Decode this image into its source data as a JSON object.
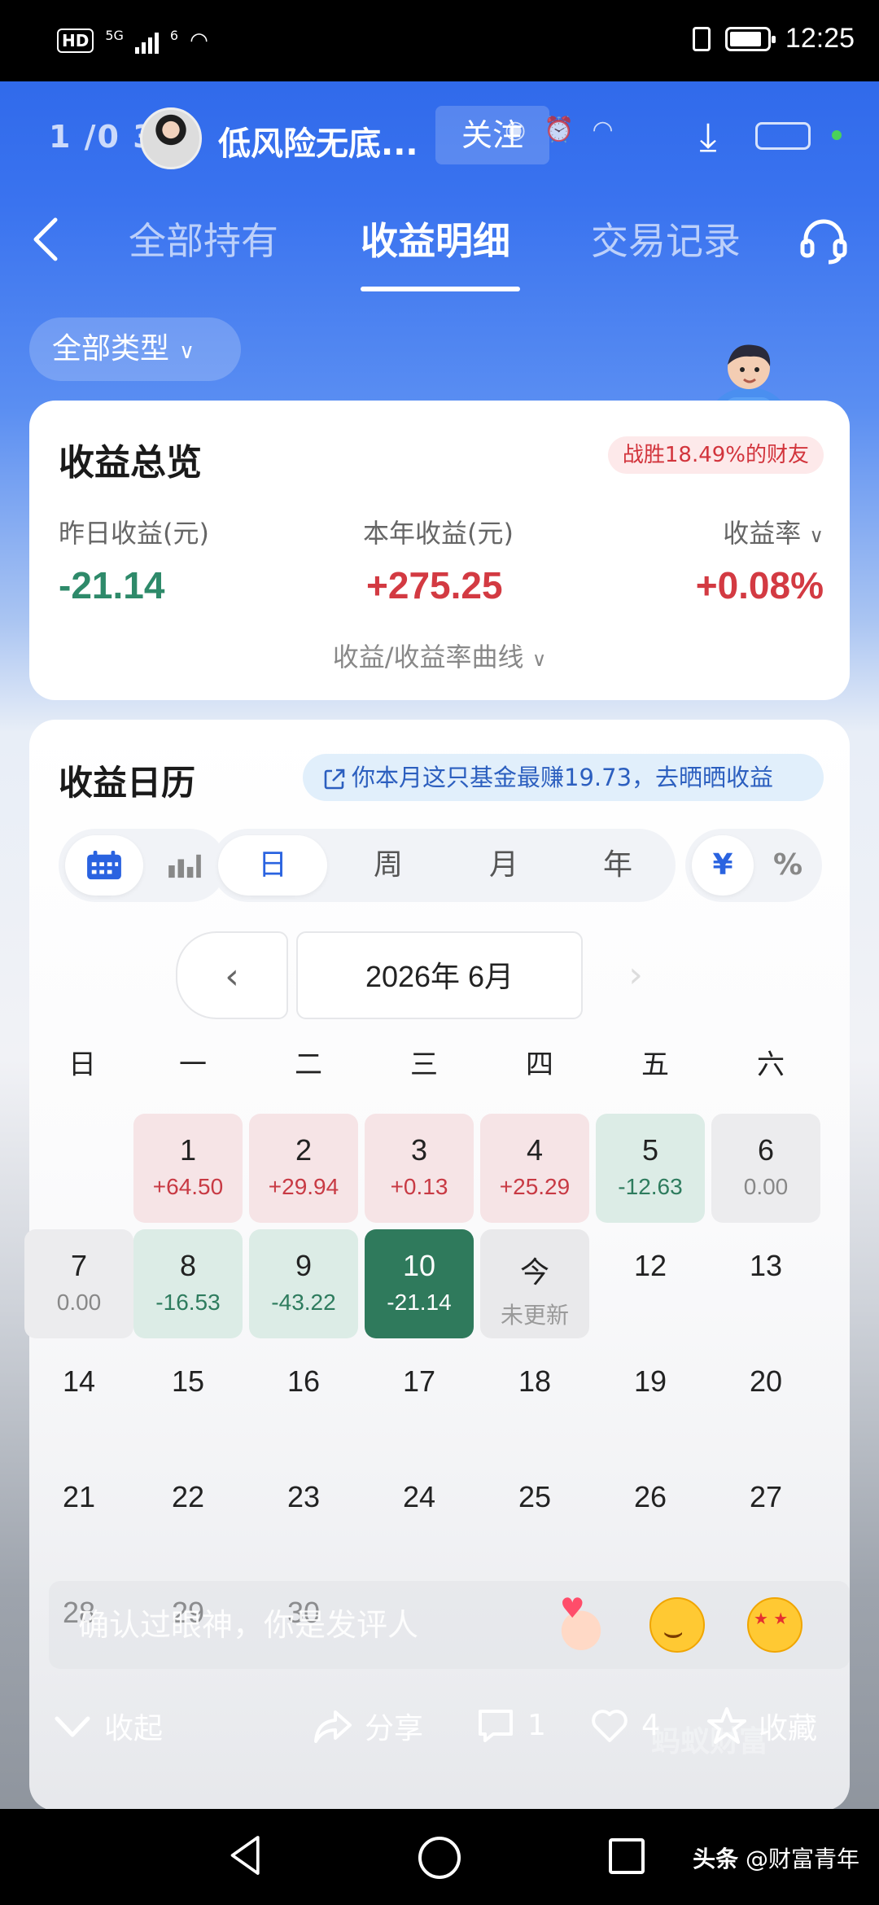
{
  "status_bar": {
    "hd": "HD",
    "signal_label": "5G",
    "wifi_label": "6",
    "time": "12:25"
  },
  "overlay": {
    "time": "1 /0 3 :",
    "title": "低风险无底...",
    "follow": "关注"
  },
  "tabs": {
    "items": [
      "全部持有",
      "收益明细",
      "交易记录"
    ],
    "active": 1
  },
  "filter": {
    "label": "全部类型"
  },
  "overview": {
    "title": "收益总览",
    "beat_badge": "战胜18.49%的财友",
    "yesterday_label": "昨日收益(元)",
    "yesterday_value": "-21.14",
    "year_label": "本年收益(元)",
    "year_value": "+275.25",
    "rate_label": "收益率",
    "rate_value": "+0.08%",
    "curve_link": "收益/收益率曲线"
  },
  "calendar": {
    "title": "收益日历",
    "promo": "你本月这只基金最赚19.73，去晒晒收益",
    "period_options": [
      "日",
      "周",
      "月",
      "年"
    ],
    "period_selected": "日",
    "unit_options": [
      "¥",
      "%"
    ],
    "month_label": "2026年 6月",
    "weekdays": [
      "日",
      "一",
      "二",
      "三",
      "四",
      "五",
      "六"
    ],
    "days": [
      {
        "n": "1",
        "v": "+64.50",
        "k": "up",
        "col": 1,
        "row": 0
      },
      {
        "n": "2",
        "v": "+29.94",
        "k": "up",
        "col": 2,
        "row": 0
      },
      {
        "n": "3",
        "v": "+0.13",
        "k": "up",
        "col": 3,
        "row": 0
      },
      {
        "n": "4",
        "v": "+25.29",
        "k": "up",
        "col": 4,
        "row": 0
      },
      {
        "n": "5",
        "v": "-12.63",
        "k": "down",
        "col": 5,
        "row": 0
      },
      {
        "n": "6",
        "v": "0.00",
        "k": "zero",
        "col": 6,
        "row": 0
      },
      {
        "n": "7",
        "v": "0.00",
        "k": "zero",
        "col": 0,
        "row": 1
      },
      {
        "n": "8",
        "v": "-16.53",
        "k": "down",
        "col": 1,
        "row": 1
      },
      {
        "n": "9",
        "v": "-43.22",
        "k": "down",
        "col": 2,
        "row": 1
      },
      {
        "n": "10",
        "v": "-21.14",
        "k": "sel",
        "col": 3,
        "row": 1
      },
      {
        "n": "今",
        "v": "未更新",
        "k": "today",
        "col": 4,
        "row": 1
      },
      {
        "n": "12",
        "v": "",
        "k": "",
        "col": 5,
        "row": 1
      },
      {
        "n": "13",
        "v": "",
        "k": "",
        "col": 6,
        "row": 1
      },
      {
        "n": "14",
        "v": "",
        "k": "",
        "col": 0,
        "row": 2
      },
      {
        "n": "15",
        "v": "",
        "k": "",
        "col": 1,
        "row": 2
      },
      {
        "n": "16",
        "v": "",
        "k": "",
        "col": 2,
        "row": 2
      },
      {
        "n": "17",
        "v": "",
        "k": "",
        "col": 3,
        "row": 2
      },
      {
        "n": "18",
        "v": "",
        "k": "",
        "col": 4,
        "row": 2
      },
      {
        "n": "19",
        "v": "",
        "k": "",
        "col": 5,
        "row": 2
      },
      {
        "n": "20",
        "v": "",
        "k": "",
        "col": 6,
        "row": 2
      },
      {
        "n": "21",
        "v": "",
        "k": "",
        "col": 0,
        "row": 3
      },
      {
        "n": "22",
        "v": "",
        "k": "",
        "col": 1,
        "row": 3
      },
      {
        "n": "23",
        "v": "",
        "k": "",
        "col": 2,
        "row": 3
      },
      {
        "n": "24",
        "v": "",
        "k": "",
        "col": 3,
        "row": 3
      },
      {
        "n": "25",
        "v": "",
        "k": "",
        "col": 4,
        "row": 3
      },
      {
        "n": "26",
        "v": "",
        "k": "",
        "col": 5,
        "row": 3
      },
      {
        "n": "27",
        "v": "",
        "k": "",
        "col": 6,
        "row": 3
      },
      {
        "n": "28",
        "v": "",
        "k": "",
        "col": 0,
        "row": 4
      },
      {
        "n": "29",
        "v": "",
        "k": "",
        "col": 1,
        "row": 4
      },
      {
        "n": "30",
        "v": "",
        "k": "",
        "col": 2,
        "row": 4
      }
    ]
  },
  "comment": {
    "placeholder": "确认过眼神，你是发评人"
  },
  "actions": {
    "collapse": "收起",
    "share": "分享",
    "comments_count": "1",
    "likes_count": "4",
    "favorite": "收藏"
  },
  "watermark": "蚂蚁财富",
  "source": {
    "platform": "头条",
    "author": "@财富青年"
  },
  "colors": {
    "brand_blue": "#2a64e8",
    "gain_red": "#d33a42",
    "loss_green": "#2e8a6a"
  }
}
